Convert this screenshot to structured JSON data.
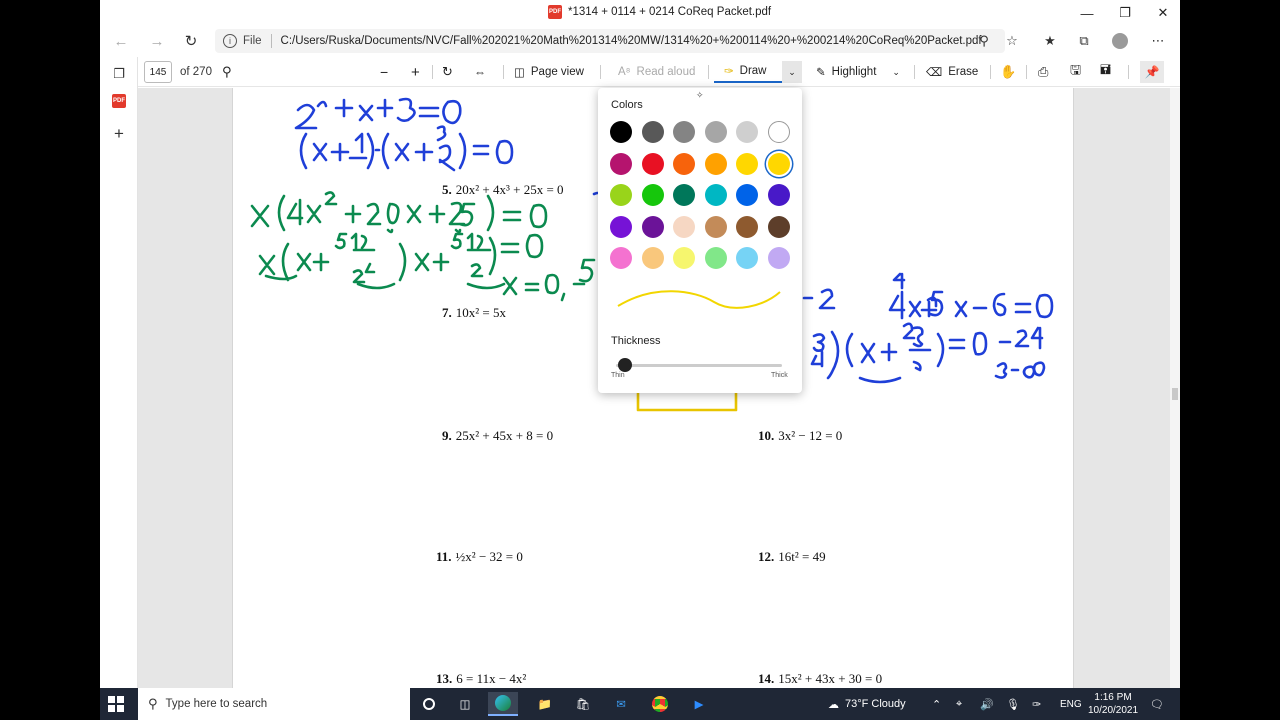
{
  "window": {
    "title": "*1314 + 0114 + 0214 CoReq Packet.pdf"
  },
  "address": {
    "scheme": "File",
    "url": "C:/Users/Ruska/Documents/NVC/Fall%202021%20Math%201314%20MW/1314%20+%200114%20+%200214%20CoReq%20Packet.pdf"
  },
  "pdf_toolbar": {
    "page_number": "145",
    "page_total": "of 270",
    "page_view": "Page view",
    "read_aloud": "Read aloud",
    "draw": "Draw",
    "highlight": "Highlight",
    "erase": "Erase"
  },
  "problems": [
    {
      "num": "5.",
      "expr": "20x² + 4x³ + 25x = 0"
    },
    {
      "num": "7.",
      "expr": "10x² = 5x"
    },
    {
      "num": "9.",
      "expr": "25x² + 45x + 8 = 0"
    },
    {
      "num": "10.",
      "expr": "3x² − 12 = 0"
    },
    {
      "num": "11.",
      "expr": "½x² − 32 = 0"
    },
    {
      "num": "12.",
      "expr": "16t² = 49"
    },
    {
      "num": "13.",
      "expr": "6 = 11x − 4x²"
    },
    {
      "num": "14.",
      "expr": "15x² + 43x + 30 = 0"
    }
  ],
  "draw_popup": {
    "colors_label": "Colors",
    "thickness_label": "Thickness",
    "thin_label": "Thin",
    "thick_label": "Thick",
    "selected_color": "#ffd700",
    "stroke_color": "#f2d600",
    "thickness_level": 0.05,
    "colors": [
      "#000000",
      "#585858",
      "#848484",
      "#a6a6a6",
      "#cfcfcf",
      "#ffffff",
      "#b5146e",
      "#e81123",
      "#f7630c",
      "#ffa100",
      "#ffd700",
      "#ffd700",
      "#99d41a",
      "#16c60c",
      "#00775a",
      "#00b7c3",
      "#0063e8",
      "#4819c8",
      "#7613d6",
      "#6b1398",
      "#f6d7c3",
      "#c38b59",
      "#8e5a2f",
      "#5d3e2a",
      "#f472d0",
      "#f9c77c",
      "#f6f66e",
      "#81e789",
      "#76d3f5",
      "#c1a9f3"
    ]
  },
  "taskbar": {
    "search_placeholder": "Type here to search",
    "weather": "73°F  Cloudy",
    "lang": "ENG",
    "time": "1:16 PM",
    "date": "10/20/2021"
  }
}
